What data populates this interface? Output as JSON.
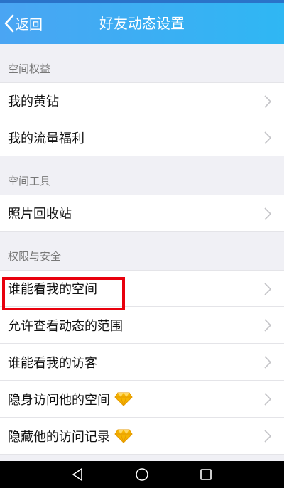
{
  "header": {
    "back_label": "返回",
    "title": "好友动态设置"
  },
  "sections": [
    {
      "title": "空间权益",
      "items": [
        {
          "label": "我的黄钻",
          "badge": null
        },
        {
          "label": "我的流量福利",
          "badge": null
        }
      ]
    },
    {
      "title": "空间工具",
      "items": [
        {
          "label": "照片回收站",
          "badge": null
        }
      ]
    },
    {
      "title": "权限与安全",
      "items": [
        {
          "label": "谁能看我的空间",
          "badge": null,
          "highlighted": true
        },
        {
          "label": "允许查看动态的范围",
          "badge": null
        },
        {
          "label": "谁能看我的访客",
          "badge": null
        },
        {
          "label": "隐身访问他的空间",
          "badge": "diamond-icon"
        },
        {
          "label": "隐藏他的访问记录",
          "badge": "diamond-icon"
        }
      ]
    }
  ],
  "navbar": {
    "buttons": [
      "back-triangle-icon",
      "home-circle-icon",
      "recents-square-icon"
    ]
  },
  "colors": {
    "header_gradient_start": "#4aa5f3",
    "header_gradient_end": "#2fb7f3",
    "highlight_border": "#e8000d",
    "diamond": "#f5b400"
  }
}
